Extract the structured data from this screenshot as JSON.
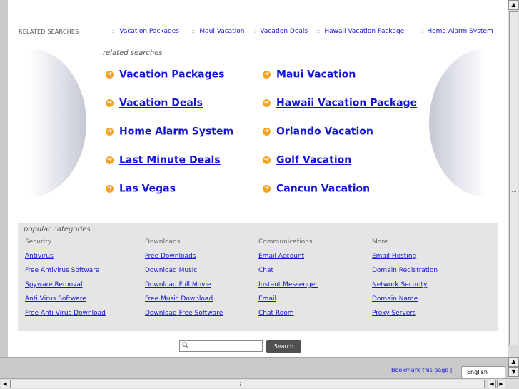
{
  "related_bar": {
    "label": "RELATED SEARCHES",
    "separator": "::",
    "items": [
      "Vacation Packages",
      "Maui Vacation",
      "Vacation Deals",
      "Hawaii Vacation Package",
      "Home Alarm System"
    ]
  },
  "related_searches": {
    "caption": "related searches",
    "arrow_glyph": "➔",
    "left": [
      "Vacation Packages",
      "Vacation Deals",
      "Home Alarm System",
      "Last Minute Deals",
      "Las Vegas"
    ],
    "right": [
      "Maui Vacation",
      "Hawaii Vacation Package",
      "Orlando Vacation",
      "Golf Vacation",
      "Cancun Vacation"
    ]
  },
  "popular": {
    "title": "popular categories",
    "columns": [
      {
        "heading": "Security",
        "links": [
          "Antivirus",
          "Free Antivirus Software",
          "Spyware Removal",
          "Anti Virus Software",
          "Free Anti Virus Download"
        ]
      },
      {
        "heading": "Downloads",
        "links": [
          "Free Downloads",
          "Download Music",
          "Download Full Movie",
          "Free Music Download",
          "Download Free Software"
        ]
      },
      {
        "heading": "Communications",
        "links": [
          "Email Account",
          "Chat",
          "Instant Messenger",
          "Email",
          "Chat Room"
        ]
      },
      {
        "heading": "More",
        "links": [
          "Email Hosting",
          "Domain Registration",
          "Network Security",
          "Domain Name",
          "Proxy Servers"
        ]
      }
    ]
  },
  "search": {
    "placeholder": "",
    "button_label": "Search"
  },
  "footer": {
    "bookmark": "Bookmark this page |",
    "language": "English"
  },
  "icons": {
    "scroll_up": "▲",
    "scroll_down": "▼",
    "scroll_left": "◀",
    "scroll_right": "▶"
  },
  "colors": {
    "link": "#1515d6",
    "arrow_badge": "#f1a321",
    "panel": "#e5e5e5"
  }
}
